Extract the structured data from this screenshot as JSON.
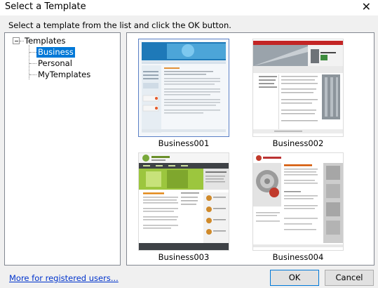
{
  "window": {
    "title": "Select a Template",
    "close_icon": "close-icon"
  },
  "instruction": "Select a template from the list and click the OK button.",
  "tree": {
    "root": "Templates",
    "items": [
      {
        "label": "Business",
        "selected": true
      },
      {
        "label": "Personal",
        "selected": false
      },
      {
        "label": "MyTemplates",
        "selected": false
      }
    ]
  },
  "templates": [
    {
      "name": "Business001",
      "selected": true
    },
    {
      "name": "Business002",
      "selected": false
    },
    {
      "name": "Business003",
      "selected": false
    },
    {
      "name": "Business004",
      "selected": false
    }
  ],
  "footer": {
    "link": "More for registered users...",
    "ok_label": "OK",
    "cancel_label": "Cancel"
  },
  "colors": {
    "selection": "#0078d7",
    "link": "#0033cc"
  }
}
